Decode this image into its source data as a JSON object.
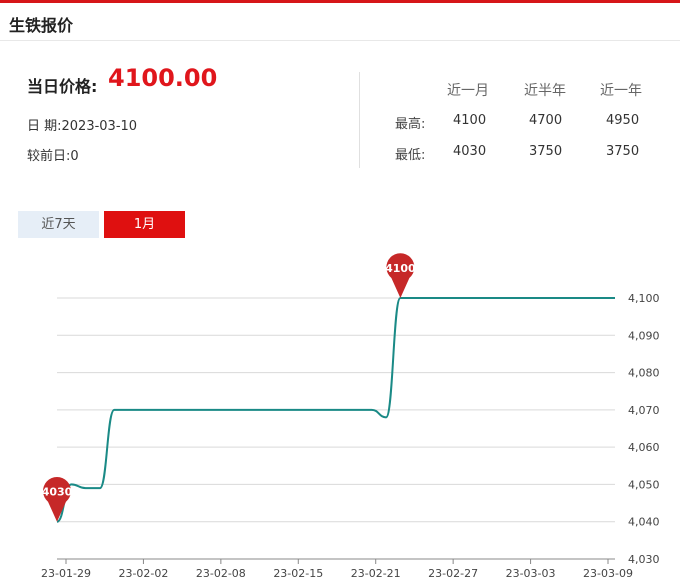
{
  "header": {
    "title": "生铁报价"
  },
  "summary": {
    "price_label": "当日价格:",
    "price_value": "4100.00",
    "date_label": "日 期:",
    "date_value": "2023-03-10",
    "change_label": "较前日:",
    "change_value": "0"
  },
  "stats": {
    "columns": [
      "近一月",
      "近半年",
      "近一年"
    ],
    "rows": [
      {
        "label": "最高:",
        "values": [
          "4100",
          "4700",
          "4950"
        ]
      },
      {
        "label": "最低:",
        "values": [
          "4030",
          "3750",
          "3750"
        ]
      }
    ]
  },
  "tabs": [
    {
      "label": "近7天",
      "active": false
    },
    {
      "label": "1月",
      "active": true
    }
  ],
  "colors": {
    "accent": "#e0161c",
    "line": "#1a8a86",
    "marker": "#c62828"
  },
  "chart_data": {
    "type": "line",
    "title": "",
    "xlabel": "",
    "ylabel": "",
    "x_ticks": [
      "23-01-29",
      "23-02-02",
      "23-02-08",
      "23-02-15",
      "23-02-21",
      "23-02-27",
      "23-03-03",
      "23-03-09"
    ],
    "y_ticks": [
      "4,030",
      "4,040",
      "4,050",
      "4,060",
      "4,070",
      "4,080",
      "4,090",
      "4,100"
    ],
    "ylim": [
      4030,
      4100
    ],
    "grid": true,
    "y_axis_side": "right",
    "series": [
      {
        "x": [
          "2023-01-29",
          "2023-01-30",
          "2023-01-31",
          "2023-02-01",
          "2023-02-02",
          "2023-02-03",
          "2023-02-20",
          "2023-02-21",
          "2023-02-22",
          "2023-02-23",
          "2023-03-09"
        ],
        "values": [
          4040,
          4050,
          4049,
          4049,
          4070,
          4070,
          4070,
          4068,
          4100,
          4100,
          4100
        ]
      }
    ],
    "markers": [
      {
        "label": "4030",
        "x": "2023-01-29",
        "value": 4040
      },
      {
        "label": "4100",
        "x": "2023-02-22",
        "value": 4100
      }
    ]
  }
}
